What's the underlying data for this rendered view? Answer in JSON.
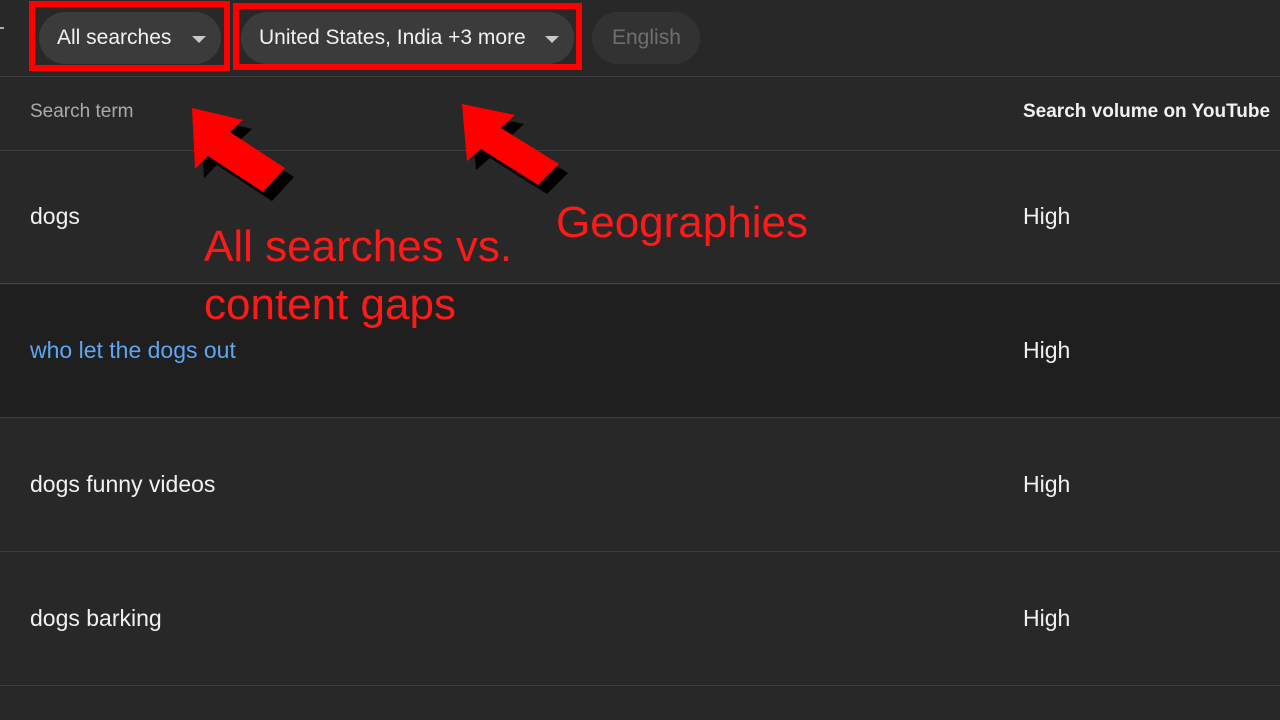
{
  "filters": {
    "search_type": "All searches",
    "geographies": "United States, India +3 more",
    "language": "English"
  },
  "table": {
    "columns": [
      "Search term",
      "Search volume on YouTube"
    ],
    "rows": [
      {
        "term": "dogs",
        "volume": "High"
      },
      {
        "term": "who let the dogs out",
        "volume": "High"
      },
      {
        "term": "dogs funny videos",
        "volume": "High"
      },
      {
        "term": "dogs barking",
        "volume": "High"
      }
    ]
  },
  "annotations": {
    "all_searches_line1": "All searches vs.",
    "all_searches_line2": "content gaps",
    "geographies": "Geographies"
  },
  "colors": {
    "background": "#282828",
    "annotation": "#ff0000",
    "link": "#5ea6f2"
  }
}
